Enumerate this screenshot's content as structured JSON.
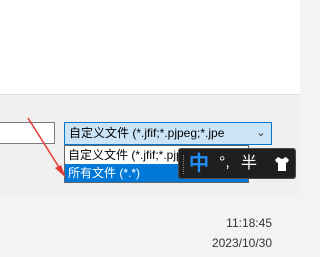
{
  "file_dialog": {
    "filetype_select_value": "自定义文件 (*.jfif;*.pjpeg;*.jpe",
    "filetype_options": [
      {
        "label": "自定义文件 (*.jfif;*.pjpeg;*.jpeg"
      },
      {
        "label": "所有文件 (*.*)"
      }
    ],
    "selected_option_index": 1
  },
  "ime_toolbar": {
    "mode_label": "中",
    "punct_label": "°,",
    "width_label": "半",
    "skin_icon": "shirt-icon"
  },
  "taskbar": {
    "time": "11:18:45",
    "date": "2023/10/30"
  },
  "colors": {
    "selection": "#0078d7",
    "select_bg": "#cce4f7",
    "arrow": "#e53935"
  }
}
